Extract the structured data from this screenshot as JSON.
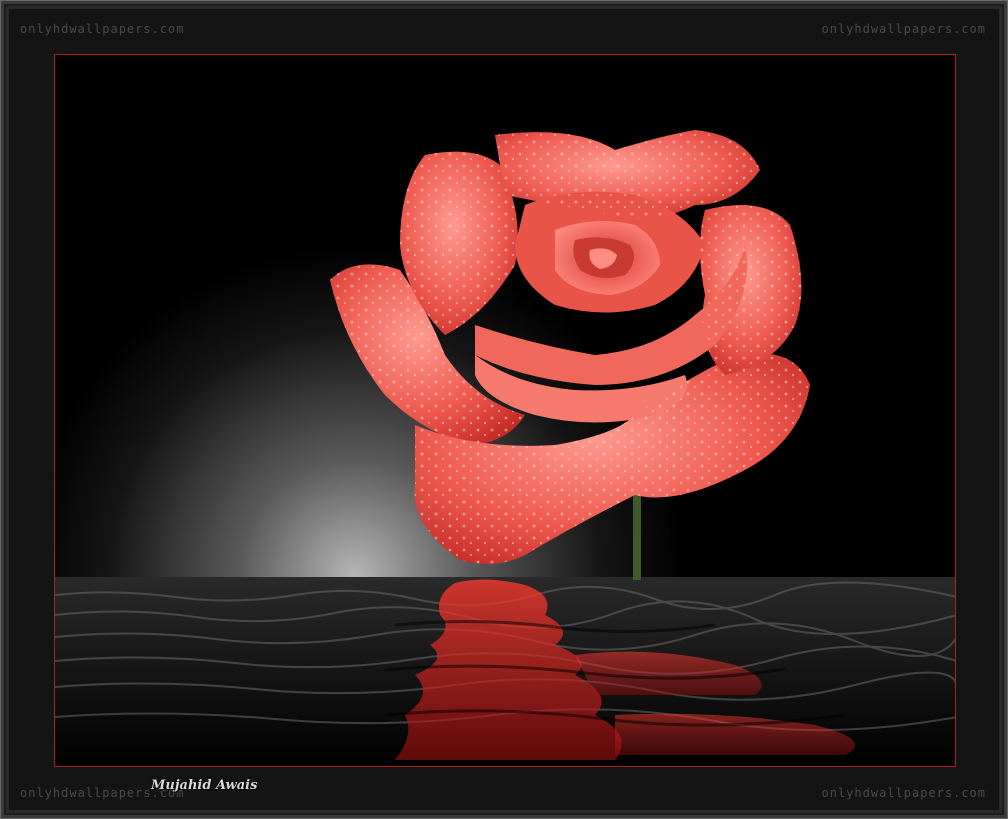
{
  "watermarks": {
    "top_left": "onlyhdwallpapers.com",
    "top_right": "onlyhdwallpapers.com",
    "bottom_left": "onlyhdwallpapers.com",
    "bottom_right": "onlyhdwallpapers.com"
  },
  "signature": "Mujahid Awais",
  "colors": {
    "rose": "#e8463f",
    "rose_highlight": "#ff8f86",
    "frame_accent": "#b02020",
    "background": "#000000"
  }
}
